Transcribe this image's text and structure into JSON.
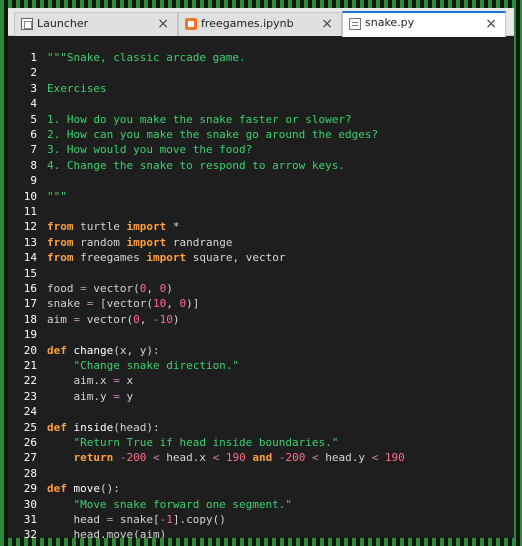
{
  "tabs": [
    {
      "label": "Launcher",
      "icon": "launcher-icon",
      "active": false
    },
    {
      "label": "freegames.ipynb",
      "icon": "notebook-icon",
      "active": false
    },
    {
      "label": "snake.py",
      "icon": "python-file-icon",
      "active": true
    }
  ],
  "editor": {
    "lines": [
      {
        "n": "1",
        "tokens": [
          {
            "t": "\"\"\"Snake, classic arcade game.",
            "c": "str"
          }
        ]
      },
      {
        "n": "2",
        "tokens": []
      },
      {
        "n": "3",
        "tokens": [
          {
            "t": "Exercises",
            "c": "str"
          }
        ]
      },
      {
        "n": "4",
        "tokens": []
      },
      {
        "n": "5",
        "tokens": [
          {
            "t": "1. How do you make the snake faster or slower?",
            "c": "str"
          }
        ]
      },
      {
        "n": "6",
        "tokens": [
          {
            "t": "2. How can you make the snake go around the edges?",
            "c": "str"
          }
        ]
      },
      {
        "n": "7",
        "tokens": [
          {
            "t": "3. How would you move the food?",
            "c": "str"
          }
        ]
      },
      {
        "n": "8",
        "tokens": [
          {
            "t": "4. Change the snake to respond to arrow keys.",
            "c": "str"
          }
        ]
      },
      {
        "n": "9",
        "tokens": []
      },
      {
        "n": "10",
        "tokens": [
          {
            "t": "\"\"\"",
            "c": "str"
          }
        ]
      },
      {
        "n": "11",
        "tokens": []
      },
      {
        "n": "12",
        "tokens": [
          {
            "t": "from",
            "c": "kw"
          },
          {
            "t": " turtle ",
            "c": "p"
          },
          {
            "t": "import",
            "c": "kw"
          },
          {
            "t": " *",
            "c": "p"
          }
        ]
      },
      {
        "n": "13",
        "tokens": [
          {
            "t": "from",
            "c": "kw"
          },
          {
            "t": " random ",
            "c": "p"
          },
          {
            "t": "import",
            "c": "kw"
          },
          {
            "t": " randrange",
            "c": "p"
          }
        ]
      },
      {
        "n": "14",
        "tokens": [
          {
            "t": "from",
            "c": "kw"
          },
          {
            "t": " freegames ",
            "c": "p"
          },
          {
            "t": "import",
            "c": "kw"
          },
          {
            "t": " square, vector",
            "c": "p"
          }
        ]
      },
      {
        "n": "15",
        "tokens": []
      },
      {
        "n": "16",
        "tokens": [
          {
            "t": "food ",
            "c": "p"
          },
          {
            "t": "=",
            "c": "op"
          },
          {
            "t": " vector(",
            "c": "p"
          },
          {
            "t": "0",
            "c": "num"
          },
          {
            "t": ", ",
            "c": "p"
          },
          {
            "t": "0",
            "c": "num"
          },
          {
            "t": ")",
            "c": "p"
          }
        ]
      },
      {
        "n": "17",
        "tokens": [
          {
            "t": "snake ",
            "c": "p"
          },
          {
            "t": "=",
            "c": "op"
          },
          {
            "t": " [vector(",
            "c": "p"
          },
          {
            "t": "10",
            "c": "num"
          },
          {
            "t": ", ",
            "c": "p"
          },
          {
            "t": "0",
            "c": "num"
          },
          {
            "t": ")]",
            "c": "p"
          }
        ]
      },
      {
        "n": "18",
        "tokens": [
          {
            "t": "aim ",
            "c": "p"
          },
          {
            "t": "=",
            "c": "op"
          },
          {
            "t": " vector(",
            "c": "p"
          },
          {
            "t": "0",
            "c": "num"
          },
          {
            "t": ", ",
            "c": "p"
          },
          {
            "t": "-10",
            "c": "num"
          },
          {
            "t": ")",
            "c": "p"
          }
        ]
      },
      {
        "n": "19",
        "tokens": []
      },
      {
        "n": "20",
        "tokens": [
          {
            "t": "def",
            "c": "kw"
          },
          {
            "t": " ",
            "c": "p"
          },
          {
            "t": "change",
            "c": "fn"
          },
          {
            "t": "(x, y):",
            "c": "p"
          }
        ]
      },
      {
        "n": "21",
        "tokens": [
          {
            "t": "    \"Change snake direction.\"",
            "c": "str"
          }
        ]
      },
      {
        "n": "22",
        "tokens": [
          {
            "t": "    aim.x ",
            "c": "p"
          },
          {
            "t": "=",
            "c": "op"
          },
          {
            "t": " x",
            "c": "p"
          }
        ]
      },
      {
        "n": "23",
        "tokens": [
          {
            "t": "    aim.y ",
            "c": "p"
          },
          {
            "t": "=",
            "c": "op"
          },
          {
            "t": " y",
            "c": "p"
          }
        ]
      },
      {
        "n": "24",
        "tokens": []
      },
      {
        "n": "25",
        "tokens": [
          {
            "t": "def",
            "c": "kw"
          },
          {
            "t": " ",
            "c": "p"
          },
          {
            "t": "inside",
            "c": "fn"
          },
          {
            "t": "(head):",
            "c": "p"
          }
        ]
      },
      {
        "n": "26",
        "tokens": [
          {
            "t": "    \"Return True if head inside boundaries.\"",
            "c": "str"
          }
        ]
      },
      {
        "n": "27",
        "tokens": [
          {
            "t": "    ",
            "c": "p"
          },
          {
            "t": "return",
            "c": "kw"
          },
          {
            "t": " ",
            "c": "p"
          },
          {
            "t": "-200",
            "c": "num"
          },
          {
            "t": " ",
            "c": "p"
          },
          {
            "t": "<",
            "c": "op"
          },
          {
            "t": " head.x ",
            "c": "p"
          },
          {
            "t": "<",
            "c": "op"
          },
          {
            "t": " ",
            "c": "p"
          },
          {
            "t": "190",
            "c": "num"
          },
          {
            "t": " ",
            "c": "p"
          },
          {
            "t": "and",
            "c": "kw"
          },
          {
            "t": " ",
            "c": "p"
          },
          {
            "t": "-200",
            "c": "num"
          },
          {
            "t": " ",
            "c": "p"
          },
          {
            "t": "<",
            "c": "op"
          },
          {
            "t": " head.y ",
            "c": "p"
          },
          {
            "t": "<",
            "c": "op"
          },
          {
            "t": " ",
            "c": "p"
          },
          {
            "t": "190",
            "c": "num"
          }
        ]
      },
      {
        "n": "28",
        "tokens": []
      },
      {
        "n": "29",
        "tokens": [
          {
            "t": "def",
            "c": "kw"
          },
          {
            "t": " ",
            "c": "p"
          },
          {
            "t": "move",
            "c": "fn"
          },
          {
            "t": "():",
            "c": "p"
          }
        ]
      },
      {
        "n": "30",
        "tokens": [
          {
            "t": "    \"Move snake forward one segment.\"",
            "c": "str"
          }
        ]
      },
      {
        "n": "31",
        "tokens": [
          {
            "t": "    head ",
            "c": "p"
          },
          {
            "t": "=",
            "c": "op"
          },
          {
            "t": " snake[",
            "c": "p"
          },
          {
            "t": "-1",
            "c": "num"
          },
          {
            "t": "].copy()",
            "c": "p"
          }
        ]
      },
      {
        "n": "32",
        "tokens": [
          {
            "t": "    head.move(aim)",
            "c": "p"
          }
        ]
      }
    ]
  }
}
